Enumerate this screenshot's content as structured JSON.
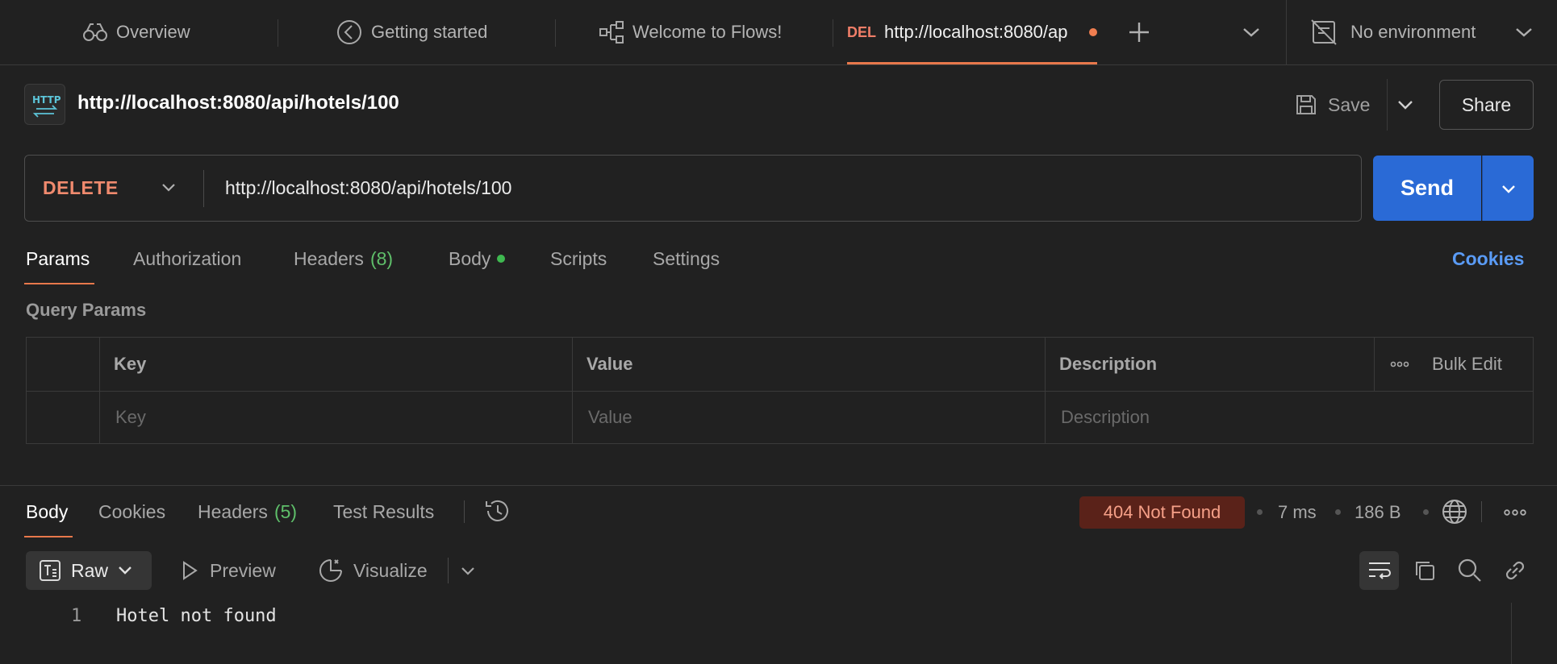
{
  "tabs": [
    {
      "label": "Overview",
      "icon": "binoculars-icon"
    },
    {
      "label": "Getting started",
      "icon": "compass-icon"
    },
    {
      "label": "Welcome to Flows!",
      "icon": "flows-icon"
    },
    {
      "method_badge": "DEL",
      "label": "http://localhost:8080/ap",
      "icon": "unsaved-dot",
      "active": true
    }
  ],
  "environment": {
    "label": "No environment",
    "icon": "no-environment-icon"
  },
  "request": {
    "title": "http://localhost:8080/api/hotels/100",
    "icon": "http-icon",
    "save_label": "Save",
    "share_label": "Share",
    "method": "DELETE",
    "url": "http://localhost:8080/api/hotels/100",
    "send_label": "Send"
  },
  "request_tabs": {
    "params": "Params",
    "authorization": "Authorization",
    "headers": "Headers",
    "headers_count": "(8)",
    "body": "Body",
    "scripts": "Scripts",
    "settings": "Settings",
    "cookies": "Cookies"
  },
  "query_params": {
    "title": "Query Params",
    "headers": {
      "key": "Key",
      "value": "Value",
      "description": "Description",
      "bulk_edit": "Bulk Edit"
    },
    "placeholders": {
      "key": "Key",
      "value": "Value",
      "description": "Description"
    }
  },
  "response": {
    "tabs": {
      "body": "Body",
      "cookies": "Cookies",
      "headers": "Headers",
      "headers_count": "(5)",
      "test_results": "Test Results"
    },
    "status": "404 Not Found",
    "time": "7 ms",
    "size": "186 B",
    "format": {
      "raw": "Raw",
      "preview": "Preview",
      "visualize": "Visualize"
    },
    "lines": [
      {
        "number": "1",
        "text": "Hotel not found"
      }
    ]
  },
  "colors": {
    "accent": "#e8784b",
    "send": "#2a6ad6",
    "method_delete": "#f08a6e",
    "status_error_bg": "#5a2219",
    "link": "#5a9bf5",
    "count_green": "#5fbf6a"
  }
}
